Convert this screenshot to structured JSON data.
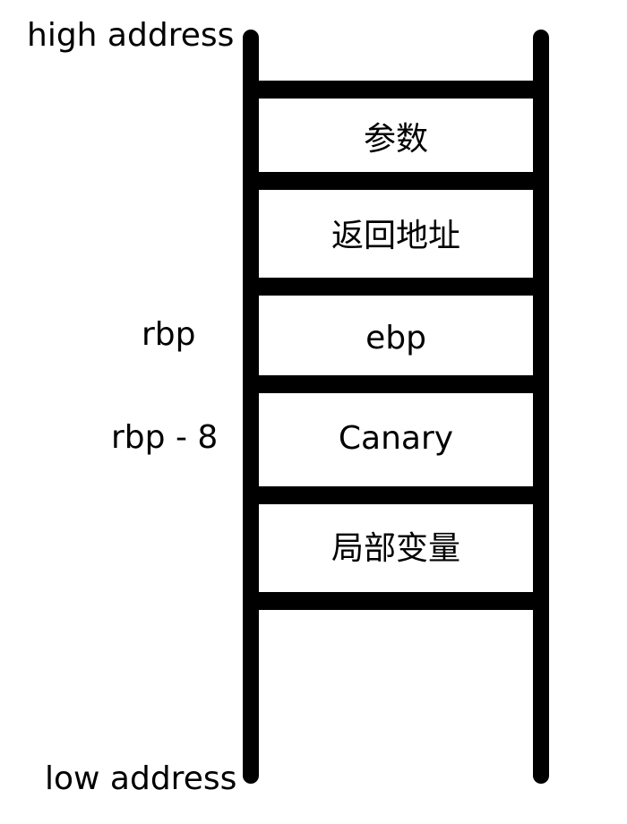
{
  "labels": {
    "high_address": "high address",
    "low_address": "low address"
  },
  "stack_slots": [
    {
      "text": "参数"
    },
    {
      "text": "返回地址"
    },
    {
      "text": "ebp"
    },
    {
      "text": "Canary"
    },
    {
      "text": "局部变量"
    }
  ],
  "pointers": {
    "rbp": "rbp",
    "rbp_minus_8": "rbp - 8"
  },
  "colors": {
    "line": "#000000",
    "background": "#ffffff"
  }
}
